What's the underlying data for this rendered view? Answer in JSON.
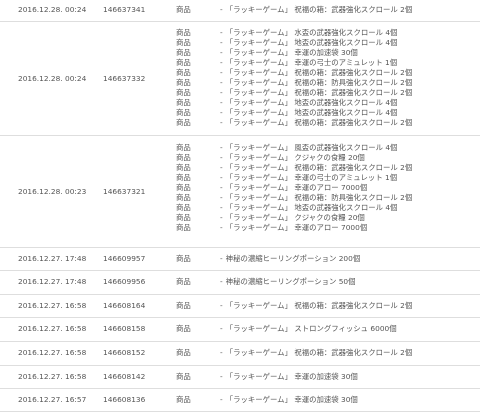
{
  "rows": [
    {
      "date": "2016.12.28. 00:24",
      "id": "146637341",
      "items": [
        {
          "type": "商品",
          "name": "「ラッキーゲーム」 祝福の箱：武器強化スクロール 2個"
        }
      ]
    },
    {
      "date": "2016.12.28. 00:24",
      "id": "146637332",
      "items": [
        {
          "type": "商品",
          "name": "「ラッキーゲーム」 水盃の武器強化スクロール 4個"
        },
        {
          "type": "商品",
          "name": "「ラッキーゲーム」 地盃の武器強化スクロール 4個"
        },
        {
          "type": "商品",
          "name": "「ラッキーゲーム」 幸運の加速袋 30個"
        },
        {
          "type": "商品",
          "name": "「ラッキーゲーム」 幸運の弓士のアミュレット 1個"
        },
        {
          "type": "商品",
          "name": "「ラッキーゲーム」 祝福の箱：武器強化スクロール 2個"
        },
        {
          "type": "商品",
          "name": "「ラッキーゲーム」 祝福の箱：防具強化スクロール 2個"
        },
        {
          "type": "商品",
          "name": "「ラッキーゲーム」 祝福の箱：武器強化スクロール 2個"
        },
        {
          "type": "商品",
          "name": "「ラッキーゲーム」 地盃の武器強化スクロール 4個"
        },
        {
          "type": "商品",
          "name": "「ラッキーゲーム」 地盃の武器強化スクロール 4個"
        },
        {
          "type": "商品",
          "name": "「ラッキーゲーム」 祝福の箱：武器強化スクロール 2個"
        }
      ]
    },
    {
      "date": "2016.12.28. 00:23",
      "id": "146637321",
      "items": [
        {
          "type": "商品",
          "name": "「ラッキーゲーム」 風盃の武器強化スクロール 4個"
        },
        {
          "type": "商品",
          "name": "「ラッキーゲーム」 クジャクの食糧 20個"
        },
        {
          "type": "商品",
          "name": "「ラッキーゲーム」 祝福の箱：武器強化スクロール 2個"
        },
        {
          "type": "商品",
          "name": "「ラッキーゲーム」 幸運の弓士のアミュレット 1個"
        },
        {
          "type": "商品",
          "name": "「ラッキーゲーム」 幸運のアロー 7000個"
        },
        {
          "type": "商品",
          "name": "「ラッキーゲーム」 祝福の箱：防具強化スクロール 2個"
        },
        {
          "type": "商品",
          "name": "「ラッキーゲーム」 地盃の武器強化スクロール 4個"
        },
        {
          "type": "商品",
          "name": "「ラッキーゲーム」 クジャクの食糧 20個"
        },
        {
          "type": "商品",
          "name": "「ラッキーゲーム」 幸運のアロー 7000個"
        }
      ]
    },
    {
      "date": "2016.12.27. 17:48",
      "id": "146609957",
      "items": [
        {
          "type": "商品",
          "name": "神秘の濃縮ヒーリングポーション 200個"
        }
      ]
    },
    {
      "date": "2016.12.27. 17:48",
      "id": "146609956",
      "items": [
        {
          "type": "商品",
          "name": "神秘の濃縮ヒーリングポーション 50個"
        }
      ]
    },
    {
      "date": "2016.12.27. 16:58",
      "id": "146608164",
      "items": [
        {
          "type": "商品",
          "name": "「ラッキーゲーム」 祝福の箱：武器強化スクロール 2個"
        }
      ]
    },
    {
      "date": "2016.12.27. 16:58",
      "id": "146608158",
      "items": [
        {
          "type": "商品",
          "name": "「ラッキーゲーム」 ストロングフィッシュ 6000個"
        }
      ]
    },
    {
      "date": "2016.12.27. 16:58",
      "id": "146608152",
      "items": [
        {
          "type": "商品",
          "name": "「ラッキーゲーム」 祝福の箱：武器強化スクロール 2個"
        }
      ]
    },
    {
      "date": "2016.12.27. 16:58",
      "id": "146608142",
      "items": [
        {
          "type": "商品",
          "name": "「ラッキーゲーム」 幸運の加速袋 30個"
        }
      ]
    },
    {
      "date": "2016.12.27. 16:57",
      "id": "146608136",
      "items": [
        {
          "type": "商品",
          "name": "「ラッキーゲーム」 幸運の加速袋 30個"
        }
      ]
    }
  ],
  "dash": "-"
}
